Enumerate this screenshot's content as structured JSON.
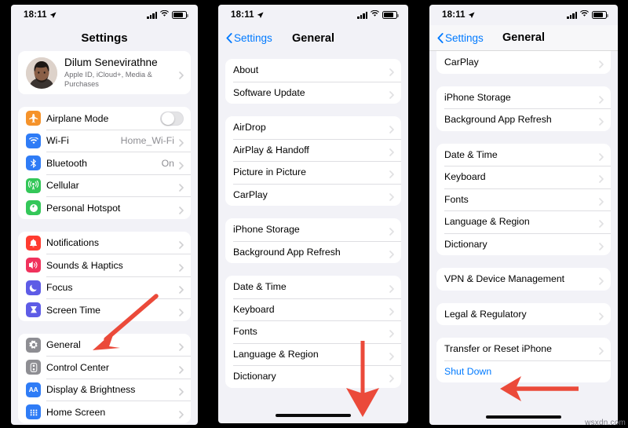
{
  "meta": {
    "watermark": "wsxdn.com"
  },
  "status_bar": {
    "time": "18:11",
    "location_icon": "location-arrow-icon",
    "cellular_icon": "cellular-bars-icon",
    "wifi_icon": "wifi-icon",
    "battery_icon": "battery-icon"
  },
  "colors": {
    "accent_blue": "#007aff",
    "annotation_red": "#eb4a3a",
    "page_background": "#f2f2f7",
    "card_background": "#ffffff",
    "secondary_text": "#8e8e93"
  },
  "panel1": {
    "nav": {
      "title": "Settings"
    },
    "profile": {
      "name": "Dilum Senevirathne",
      "subtitle": "Apple ID, iCloud+, Media & Purchases",
      "avatar": "user-avatar"
    },
    "groups": [
      {
        "rows": [
          {
            "label": "Airplane Mode",
            "icon": "airplane-icon",
            "icon_color": "#f5932b",
            "control": "toggle",
            "toggle_on": false
          },
          {
            "label": "Wi-Fi",
            "icon": "wifi-icon",
            "icon_color": "#2f7cf6",
            "value": "Home_Wi-Fi",
            "control": "chevron"
          },
          {
            "label": "Bluetooth",
            "icon": "bluetooth-icon",
            "icon_color": "#2f7cf6",
            "value": "On",
            "control": "chevron"
          },
          {
            "label": "Cellular",
            "icon": "cellular-antenna-icon",
            "icon_color": "#34c759",
            "value": "",
            "control": "chevron"
          },
          {
            "label": "Personal Hotspot",
            "icon": "hotspot-icon",
            "icon_color": "#34c759",
            "value": "",
            "control": "chevron"
          }
        ]
      },
      {
        "rows": [
          {
            "label": "Notifications",
            "icon": "bell-icon",
            "icon_color": "#ff3b30",
            "value": "",
            "control": "chevron"
          },
          {
            "label": "Sounds & Haptics",
            "icon": "speaker-icon",
            "icon_color": "#f0325c",
            "value": "",
            "control": "chevron"
          },
          {
            "label": "Focus",
            "icon": "moon-icon",
            "icon_color": "#5e5ce6",
            "value": "",
            "control": "chevron"
          },
          {
            "label": "Screen Time",
            "icon": "hourglass-icon",
            "icon_color": "#5e5ce6",
            "value": "",
            "control": "chevron"
          }
        ]
      },
      {
        "rows": [
          {
            "label": "General",
            "icon": "gear-icon",
            "icon_color": "#8e8e93",
            "value": "",
            "control": "chevron"
          },
          {
            "label": "Control Center",
            "icon": "control-center-icon",
            "icon_color": "#8e8e93",
            "value": "",
            "control": "chevron"
          },
          {
            "label": "Display & Brightness",
            "icon": "display-brightness-icon",
            "icon_color": "#2f7cf6",
            "value": "",
            "control": "chevron"
          },
          {
            "label": "Home Screen",
            "icon": "home-screen-icon",
            "icon_color": "#2f7cf6",
            "value": "",
            "control": "chevron"
          }
        ]
      }
    ]
  },
  "panel2": {
    "nav": {
      "back_label": "Settings",
      "title": "General"
    },
    "groups": [
      {
        "rows": [
          {
            "label": "About"
          },
          {
            "label": "Software Update"
          }
        ]
      },
      {
        "rows": [
          {
            "label": "AirDrop"
          },
          {
            "label": "AirPlay & Handoff"
          },
          {
            "label": "Picture in Picture"
          },
          {
            "label": "CarPlay"
          }
        ]
      },
      {
        "rows": [
          {
            "label": "iPhone Storage"
          },
          {
            "label": "Background App Refresh"
          }
        ]
      },
      {
        "rows": [
          {
            "label": "Date & Time"
          },
          {
            "label": "Keyboard"
          },
          {
            "label": "Fonts"
          },
          {
            "label": "Language & Region"
          },
          {
            "label": "Dictionary"
          }
        ]
      }
    ]
  },
  "panel3": {
    "nav": {
      "back_label": "Settings",
      "title": "General"
    },
    "groups": [
      {
        "flushtop": true,
        "rows": [
          {
            "label": "CarPlay"
          }
        ]
      },
      {
        "rows": [
          {
            "label": "iPhone Storage"
          },
          {
            "label": "Background App Refresh"
          }
        ]
      },
      {
        "rows": [
          {
            "label": "Date & Time"
          },
          {
            "label": "Keyboard"
          },
          {
            "label": "Fonts"
          },
          {
            "label": "Language & Region"
          },
          {
            "label": "Dictionary"
          }
        ]
      },
      {
        "rows": [
          {
            "label": "VPN & Device Management"
          }
        ]
      },
      {
        "rows": [
          {
            "label": "Legal & Regulatory"
          }
        ]
      },
      {
        "rows": [
          {
            "label": "Transfer or Reset iPhone"
          },
          {
            "label": "Shut Down",
            "blue": true,
            "no_chevron": true
          }
        ]
      }
    ]
  },
  "annotations": [
    {
      "name": "arrow-to-general",
      "direction": "down-left",
      "target": "General"
    },
    {
      "name": "arrow-scroll-down",
      "direction": "down",
      "target": "scroll to bottom"
    },
    {
      "name": "arrow-to-shut-down",
      "direction": "left",
      "target": "Shut Down"
    }
  ]
}
